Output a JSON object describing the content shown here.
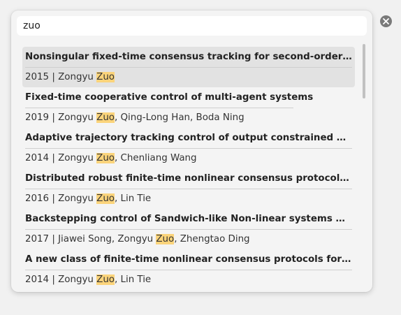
{
  "search": {
    "query": "zuo"
  },
  "results": [
    {
      "title": "Nonsingular fixed-time consensus tracking for second-order multi-agent networks",
      "year": "2015",
      "before": "Zongyu ",
      "match": "Zuo",
      "after": "",
      "selected": true
    },
    {
      "title": "Fixed-time cooperative control of multi-agent systems",
      "year": "2019",
      "before": "Zongyu ",
      "match": "Zuo",
      "after": ", Qing-Long Han, Boda Ning",
      "selected": false
    },
    {
      "title": "Adaptive trajectory tracking control of output constrained Multi-rotors systems",
      "year": "2014",
      "before": "Zongyu ",
      "match": "Zuo",
      "after": ", Chenliang Wang",
      "selected": false
    },
    {
      "title": "Distributed robust finite-time nonlinear consensus protocols for multi-agent systems",
      "year": "2016",
      "before": "Zongyu ",
      "match": "Zuo",
      "after": ", Lin Tie",
      "selected": false
    },
    {
      "title": "Backstepping control of Sandwich-like Non-linear systems with uncertainties",
      "year": "2017",
      "before": "Jiawei Song, Zongyu ",
      "match": "Zuo",
      "after": ", Zhengtao Ding",
      "selected": false
    },
    {
      "title": "A new class of finite-time nonlinear consensus protocols for multi-agent systems",
      "year": "2014",
      "before": "Zongyu ",
      "match": "Zuo",
      "after": ", Lin Tie",
      "selected": false
    }
  ],
  "separator": " | ",
  "icons": {
    "clear": "close-circle-icon"
  },
  "colors": {
    "highlight": "#fbd47b",
    "selected_row": "#e2e2e2",
    "popup_bg": "#f4f4f4"
  }
}
